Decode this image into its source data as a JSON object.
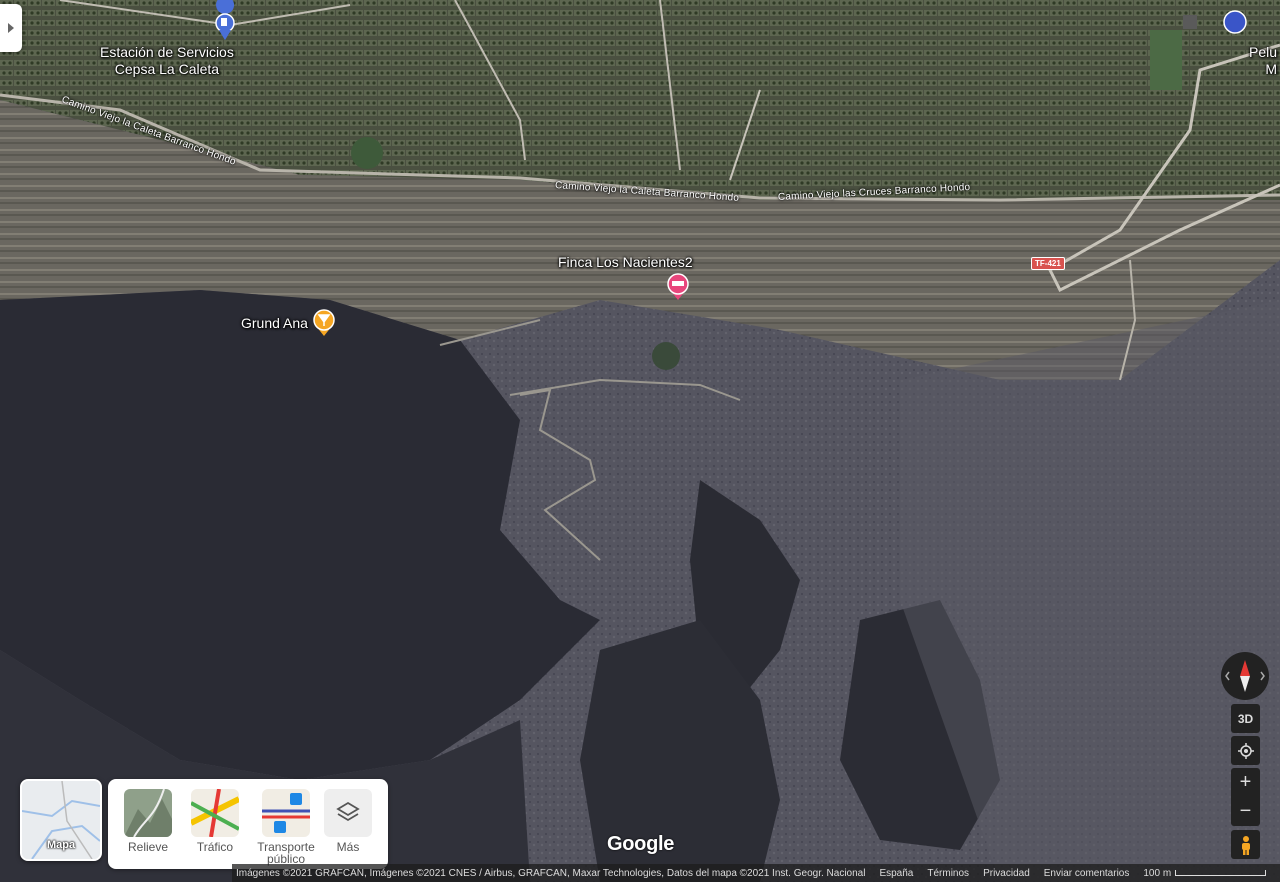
{
  "places": {
    "station_line1": "Estación de Servicios",
    "station_line2": "Cepsa La Caleta",
    "finca": "Finca Los Nacientes2",
    "grund": "Grund Ana",
    "peluq_line1": "Pelu",
    "peluq_line2": "M"
  },
  "roads": {
    "road1": "Camino Viejo la Caleta Barranco Hondo",
    "road2": "Camino Viejo la Caleta Barranco Hondo",
    "road3": "Camino Viejo las Cruces Barranco Hondo",
    "shield": "TF-421"
  },
  "controls": {
    "threed": "3D",
    "zoom_in": "+",
    "zoom_out": "−"
  },
  "minimap_label": "Mapa",
  "layers": {
    "relieve": "Relieve",
    "trafico": "Tráfico",
    "transporte_1": "Transporte",
    "transporte_2": "público",
    "mas": "Más"
  },
  "logo": "Google",
  "footer": {
    "imagery": "Imágenes ©2021 GRAFCAN, Imágenes ©2021 CNES / Airbus, GRAFCAN, Maxar Technologies, Datos del mapa ©2021 Inst. Geogr. Nacional",
    "country": "España",
    "terms": "Términos",
    "privacy": "Privacidad",
    "feedback": "Enviar comentarios",
    "scale": "100 m"
  },
  "colors": {
    "pin_red": "#e8467c",
    "pin_orange": "#f5a623",
    "pin_blue": "#4a6fd8",
    "shield_red": "#d9534f"
  }
}
